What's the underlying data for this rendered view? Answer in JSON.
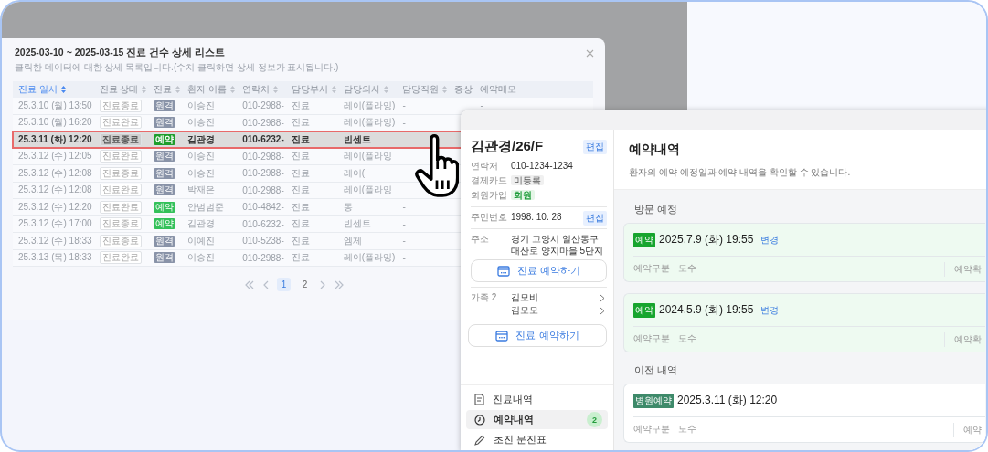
{
  "modal": {
    "title": "2025-03-10 ~ 2025-03-15 진료 건수 상세 리스트",
    "subtitle": "클릭한 데이터에 대한 상세 목록입니다.(수치 클릭하면 상세 정보가 표시됩니다.)",
    "columns": [
      {
        "label": "진료 일시",
        "sortable": true,
        "sorted": true
      },
      {
        "label": "진료 상태",
        "sortable": true,
        "sorted": false
      },
      {
        "label": "진료",
        "sortable": true,
        "sorted": false
      },
      {
        "label": "환자 이름",
        "sortable": true,
        "sorted": false
      },
      {
        "label": "연락처",
        "sortable": true,
        "sorted": false
      },
      {
        "label": "담당부서",
        "sortable": true,
        "sorted": false
      },
      {
        "label": "담당의사",
        "sortable": true,
        "sorted": false
      },
      {
        "label": "담당직원",
        "sortable": true,
        "sorted": false
      },
      {
        "label": "증상",
        "sortable": false,
        "sorted": false
      },
      {
        "label": "예약메모",
        "sortable": false,
        "sorted": false
      }
    ],
    "rows": [
      {
        "datetime": "25.3.10 (월) 13:50",
        "status": "진료종료",
        "type": {
          "label": "원격",
          "kind": "remote"
        },
        "patient": "이승진",
        "phone": "010-2988-",
        "department": "진료",
        "doctor": "레이(플라잉)",
        "staff": "-",
        "memo": "-",
        "selected": false
      },
      {
        "datetime": "25.3.10 (월) 16:20",
        "status": "진료완료",
        "type": {
          "label": "원격",
          "kind": "remote"
        },
        "patient": "이승진",
        "phone": "010-2988-",
        "department": "진료",
        "doctor": "레이(플라잉)",
        "staff": "-",
        "selected": false
      },
      {
        "datetime": "25.3.11 (화) 12:20",
        "status": "진료종료",
        "type": {
          "label": "예약",
          "kind": "reservation"
        },
        "patient": "김관경",
        "phone": "010-6232-",
        "department": "진료",
        "doctor": "빈센트",
        "selected": true
      },
      {
        "datetime": "25.3.12 (수) 12:05",
        "status": "진료완료",
        "type": {
          "label": "원격",
          "kind": "remote"
        },
        "patient": "이승진",
        "phone": "010-2988-",
        "department": "진료",
        "doctor": "레이(플라잉",
        "selected": false
      },
      {
        "datetime": "25.3.12 (수) 12:08",
        "status": "진료종료",
        "type": {
          "label": "원격",
          "kind": "remote"
        },
        "patient": "이승진",
        "phone": "010-2988-",
        "department": "진료",
        "doctor": "레이(",
        "selected": false
      },
      {
        "datetime": "25.3.12 (수) 12:08",
        "status": "진료완료",
        "type": {
          "label": "원격",
          "kind": "remote"
        },
        "patient": "박재은",
        "phone": "010-2988-",
        "department": "진료",
        "doctor": "레이(플라잉",
        "selected": false
      },
      {
        "datetime": "25.3.12 (수) 12:20",
        "status": "진료완료",
        "type": {
          "label": "예약",
          "kind": "reservation"
        },
        "patient": "안범범준",
        "phone": "010-4842-",
        "department": "진료",
        "doctor": "동",
        "staff": "-",
        "selected": false
      },
      {
        "datetime": "25.3.12 (수) 17:00",
        "status": "진료종료",
        "type": {
          "label": "예약",
          "kind": "reservation"
        },
        "patient": "김관경",
        "phone": "010-6232-",
        "department": "진료",
        "doctor": "빈센트",
        "staff": "-",
        "selected": false
      },
      {
        "datetime": "25.3.12 (수) 18:33",
        "status": "진료종료",
        "type": {
          "label": "원격",
          "kind": "remote"
        },
        "patient": "이예진",
        "phone": "010-5238-",
        "department": "진료",
        "doctor": "엠제",
        "staff": "-",
        "selected": false
      },
      {
        "datetime": "25.3.13 (목) 18:33",
        "status": "진료완료",
        "type": {
          "label": "원격",
          "kind": "remote"
        },
        "patient": "이승진",
        "phone": "010-2988-",
        "department": "진료",
        "doctor": "레이(플라잉)",
        "staff": "-",
        "selected": false
      }
    ],
    "pages": [
      {
        "label": "1",
        "selected": true
      },
      {
        "label": "2",
        "selected": false
      }
    ]
  },
  "patient": {
    "name": "김관경/26/F",
    "edit": "편집",
    "fields": [
      {
        "label": "연락처",
        "value": "010-1234-1234",
        "kind": "text"
      },
      {
        "label": "결제카드",
        "value": "미등록",
        "kind": "tag"
      },
      {
        "label": "회원가입",
        "value": "회원",
        "kind": "member"
      },
      {
        "label": "주민번호",
        "value": "1998. 10. 28",
        "kind": "editable",
        "edit": "편집"
      },
      {
        "label": "주소",
        "value": "경기 고양시 일산동구 대산로 양지마을 5단지",
        "kind": "text"
      }
    ],
    "booking_button": "진료 예약하기",
    "family": {
      "label": "가족 2",
      "members": [
        "김모비",
        "김모모"
      ]
    },
    "family_booking_button": "진료 예약하기",
    "menu": [
      {
        "label": "진료내역",
        "kind": "records",
        "selected": false
      },
      {
        "label": "예약내역",
        "kind": "reservations",
        "selected": true,
        "count": "2"
      },
      {
        "label": "초진 문진표",
        "kind": "questionnaire",
        "selected": false
      }
    ]
  },
  "reservations": {
    "title": "예약내역",
    "subtitle": "환자의 예약 예정일과 예약 내역을 확인할 수 있습니다.",
    "sections": [
      {
        "heading": "방문 예정",
        "cards": [
          {
            "tag": {
              "label": "예약",
              "kind": "reservation"
            },
            "datetime": "2025.7.9 (화) 19:55",
            "change": "변경",
            "upcoming": true,
            "detail_label": "예약구분",
            "detail_value": "도수",
            "side_label": "예약확"
          },
          {
            "tag": {
              "label": "예약",
              "kind": "reservation"
            },
            "datetime": "2024.5.9 (화) 19:55",
            "change": "변경",
            "upcoming": true,
            "detail_label": "예약구분",
            "detail_value": "도수",
            "side_label": "예약확"
          }
        ]
      },
      {
        "heading": "이전 내역",
        "cards": [
          {
            "tag": {
              "label": "병원예약",
              "kind": "hospital"
            },
            "datetime": "2025.3.11 (화) 12:20",
            "upcoming": false,
            "detail_label": "예약구분",
            "detail_value": "도수",
            "side_label": "예약"
          }
        ]
      }
    ]
  }
}
